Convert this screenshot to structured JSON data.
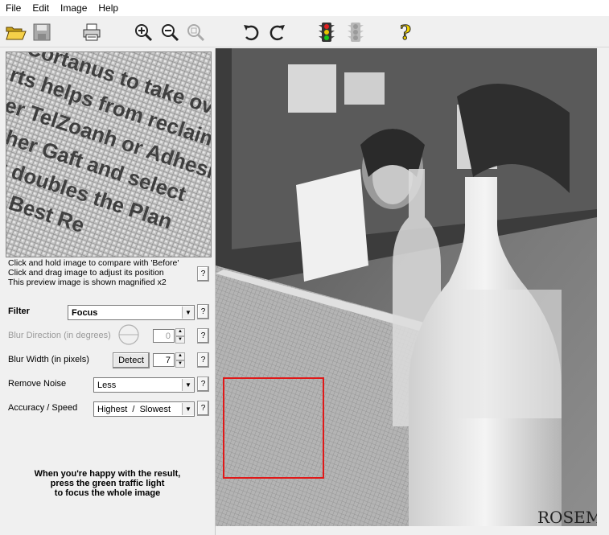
{
  "menu": [
    "File",
    "Edit",
    "Image",
    "Help"
  ],
  "toolbar_icons": [
    "open-folder-icon",
    "save-icon",
    "print-icon",
    "zoom-in-icon",
    "zoom-out-icon",
    "zoom-fit-icon",
    "undo-icon",
    "redo-icon",
    "traffic-light-green-icon",
    "traffic-light-disabled-icon",
    "help-icon"
  ],
  "preview_hint": {
    "line1": "Click and hold image to compare with 'Before'",
    "line2": "Click and drag image to adjust its position",
    "line3": "This preview image is shown magnified x2",
    "help": "?"
  },
  "filter": {
    "label": "Filter",
    "value": "Focus",
    "help": "?"
  },
  "blur_direction": {
    "label": "Blur Direction (in degrees)",
    "value": "0",
    "help": "?"
  },
  "blur_width": {
    "label": "Blur Width (in pixels)",
    "detect_label": "Detect",
    "value": "7",
    "help": "?"
  },
  "remove_noise": {
    "label": "Remove Noise",
    "value": "Less",
    "help": "?"
  },
  "accuracy": {
    "label": "Accuracy / Speed",
    "value": "Highest  /  Slowest",
    "help": "?"
  },
  "bottom_message": {
    "line1": "When you're happy with the result,",
    "line2": "press the green traffic light",
    "line3": "to focus the whole image"
  },
  "preview_text_lines": [
    "Cortanus to take over the",
    "rts helps from reclaim from",
    "her TelZoanh or Adhesive",
    "gather Gaft and select",
    "paint doubles the Plan",
    "Poster Best Re"
  ],
  "photo_text": {
    "bottle_label": "ROSEM"
  }
}
